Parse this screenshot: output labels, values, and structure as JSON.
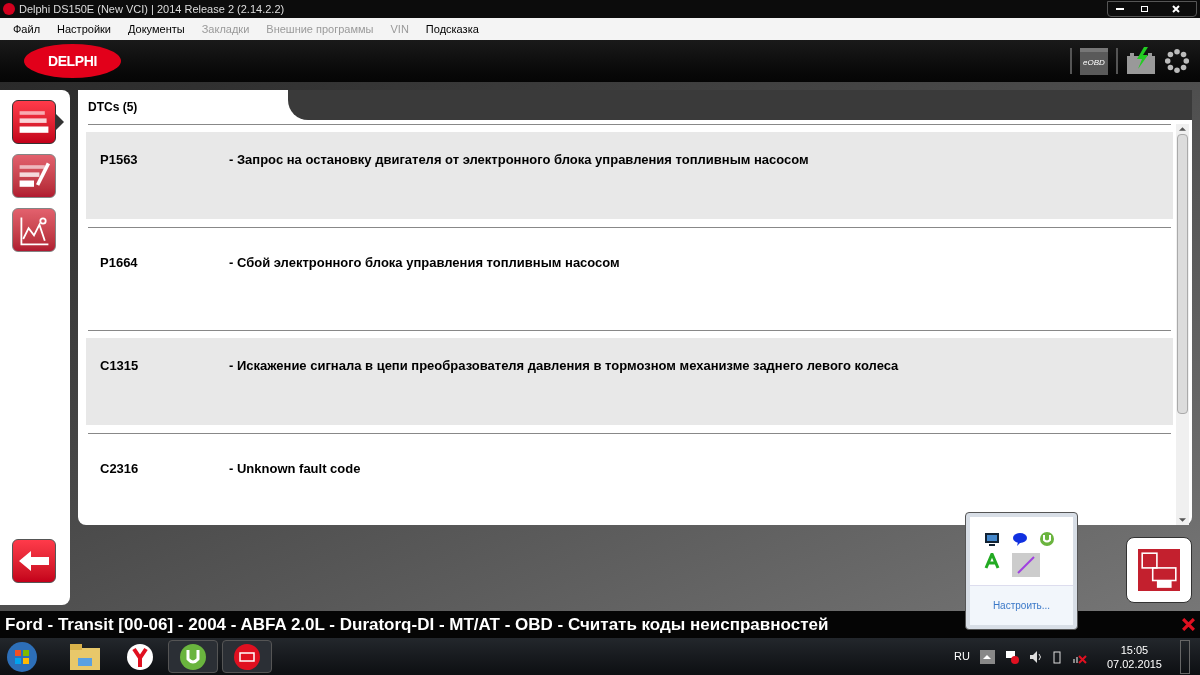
{
  "window": {
    "title": "Delphi DS150E (New VCI) | 2014 Release 2 (2.14.2.2)"
  },
  "menu": [
    {
      "label": "Файл",
      "disabled": false
    },
    {
      "label": "Настройки",
      "disabled": false
    },
    {
      "label": "Документы",
      "disabled": false
    },
    {
      "label": "Закладки",
      "disabled": true
    },
    {
      "label": "Внешние программы",
      "disabled": true
    },
    {
      "label": "VIN",
      "disabled": true
    },
    {
      "label": "Подсказка",
      "disabled": false
    }
  ],
  "header": {
    "logo": "DELPHI",
    "eobd": "eOBD"
  },
  "sidebar": {
    "items": [
      {
        "kind": "codes",
        "selected": true
      },
      {
        "kind": "erase",
        "selected": false
      },
      {
        "kind": "live",
        "selected": false
      }
    ]
  },
  "tab": {
    "label": "DTCs (5)"
  },
  "dtcs": [
    {
      "code": "P1563",
      "description": "- Запрос на остановку двигателя от электронного блока управления топливным насосом"
    },
    {
      "code": "P1664",
      "description": "- Сбой электронного блока управления топливным насосом"
    },
    {
      "code": "C1315",
      "description": "- Искажение сигнала в цепи преобразователя давления в тормозном механизме заднего левого колеса"
    },
    {
      "code": "C2316",
      "description": "- Unknown fault code"
    }
  ],
  "status_bar": "Ford - Transit [00-06] - 2004 - ABFA 2.0L - Duratorq-DI - MT/AT - OBD - Считать коды неисправностей",
  "tray_popup": {
    "link": "Настроить..."
  },
  "taskbar": {
    "language": "RU",
    "time": "15:05",
    "date": "07.02.2015"
  }
}
